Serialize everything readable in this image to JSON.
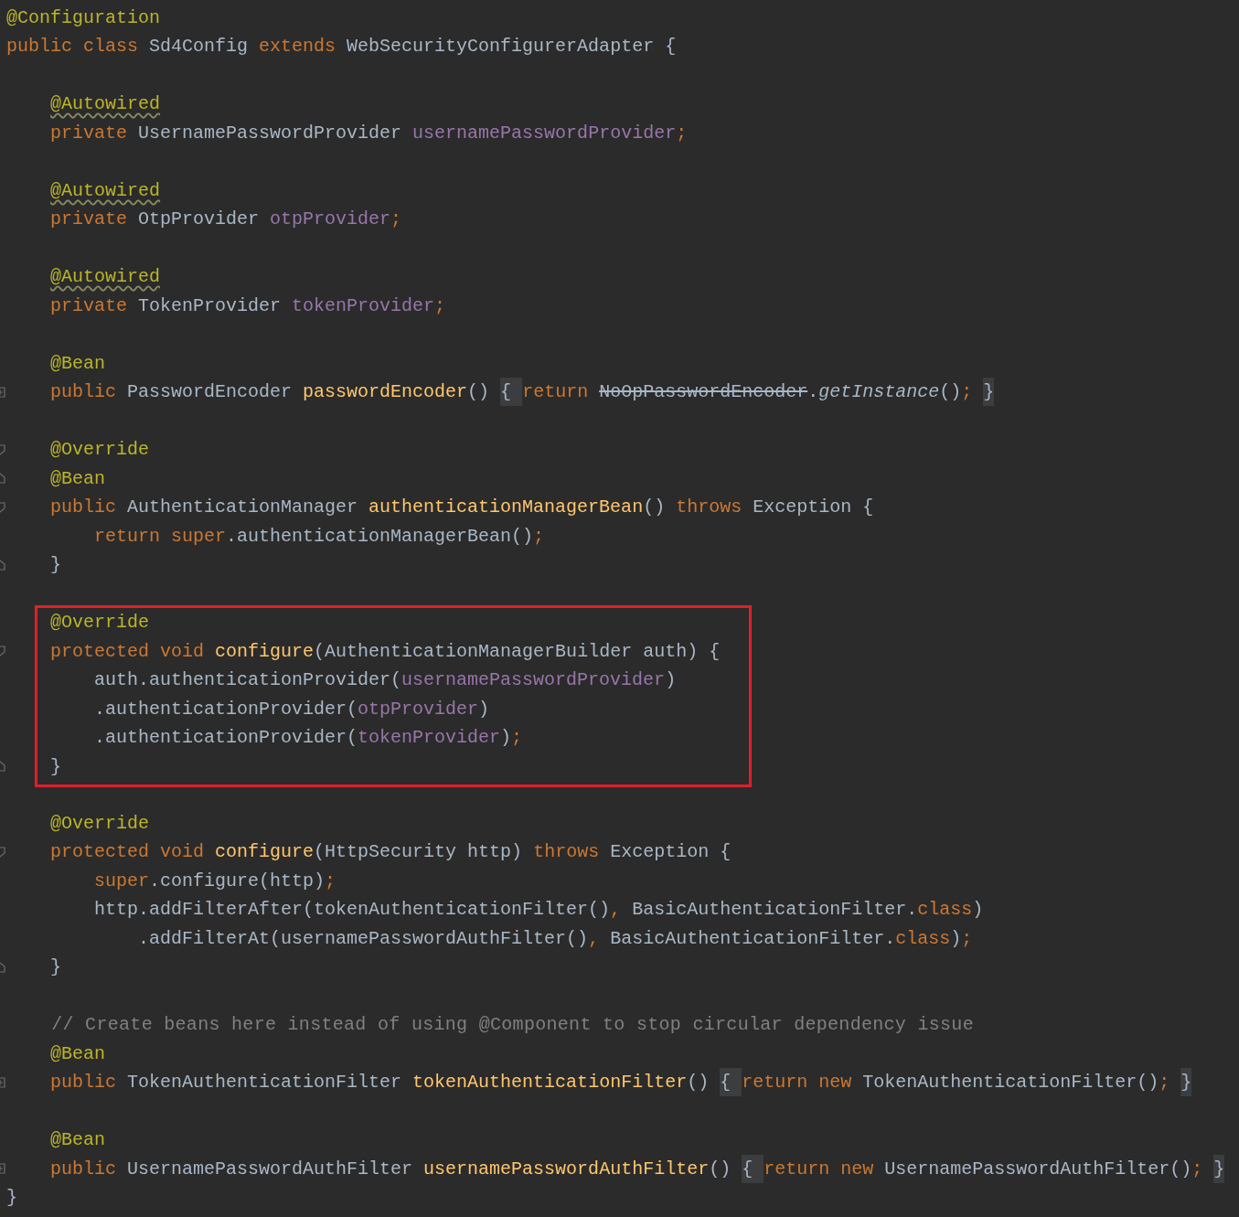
{
  "sections": [
    {
      "boxed": false,
      "lines": [
        {
          "kind": "code",
          "tokens": [
            {
              "kind": "ann",
              "text": "@Configuration"
            }
          ]
        },
        {
          "kind": "code",
          "tokens": [
            {
              "kind": "kw",
              "text": "public class "
            },
            {
              "kind": "pl",
              "text": "Sd4Config "
            },
            {
              "kind": "kw",
              "text": "extends "
            },
            {
              "kind": "pl",
              "text": "WebSecurityConfigurerAdapter {"
            }
          ]
        },
        {
          "kind": "blank"
        },
        {
          "kind": "code",
          "tokens": [
            {
              "kind": "annw",
              "text": "    @Autowired"
            }
          ]
        },
        {
          "kind": "code",
          "tokens": [
            {
              "kind": "kw",
              "text": "    private "
            },
            {
              "kind": "pl",
              "text": "UsernamePasswordProvider "
            },
            {
              "kind": "fld",
              "text": "usernamePasswordProvider"
            },
            {
              "kind": "kw",
              "text": ";"
            }
          ]
        },
        {
          "kind": "blank"
        },
        {
          "kind": "code",
          "tokens": [
            {
              "kind": "annw",
              "text": "    @Autowired"
            }
          ]
        },
        {
          "kind": "code",
          "tokens": [
            {
              "kind": "kw",
              "text": "    private "
            },
            {
              "kind": "pl",
              "text": "OtpProvider "
            },
            {
              "kind": "fld",
              "text": "otpProvider"
            },
            {
              "kind": "kw",
              "text": ";"
            }
          ]
        },
        {
          "kind": "blank"
        },
        {
          "kind": "code",
          "tokens": [
            {
              "kind": "annw",
              "text": "    @Autowired"
            }
          ]
        },
        {
          "kind": "code",
          "tokens": [
            {
              "kind": "kw",
              "text": "    private "
            },
            {
              "kind": "pl",
              "text": "TokenProvider "
            },
            {
              "kind": "fld",
              "text": "tokenProvider"
            },
            {
              "kind": "kw",
              "text": ";"
            }
          ]
        },
        {
          "kind": "blank"
        },
        {
          "kind": "code",
          "tokens": [
            {
              "kind": "ann",
              "text": "    @Bean"
            }
          ]
        },
        {
          "kind": "code",
          "fold_marker": {
            "kind": "collapsed"
          },
          "tokens": [
            {
              "kind": "kw",
              "text": "    public "
            },
            {
              "kind": "pl",
              "text": "PasswordEncoder "
            },
            {
              "kind": "mth",
              "text": "passwordEncoder"
            },
            {
              "kind": "pl",
              "text": "() "
            },
            {
              "kind": "fb",
              "text": "{ "
            },
            {
              "kind": "kw",
              "text": "return "
            },
            {
              "kind": "strike",
              "text": "NoOpPasswordEncoder"
            },
            {
              "kind": "pl",
              "text": "."
            },
            {
              "kind": "ital",
              "text": "getInstance"
            },
            {
              "kind": "pl",
              "text": "()"
            },
            {
              "kind": "kw",
              "text": "; "
            },
            {
              "kind": "fb",
              "text": "}"
            }
          ]
        },
        {
          "kind": "blank"
        },
        {
          "kind": "code",
          "fold_marker": {
            "kind": "open"
          },
          "tokens": [
            {
              "kind": "ann",
              "text": "    @Override"
            }
          ]
        },
        {
          "kind": "code",
          "fold_marker": {
            "kind": "close"
          },
          "tokens": [
            {
              "kind": "ann",
              "text": "    @Bean"
            }
          ]
        },
        {
          "kind": "code",
          "fold_marker": {
            "kind": "open"
          },
          "tokens": [
            {
              "kind": "kw",
              "text": "    public "
            },
            {
              "kind": "pl",
              "text": "AuthenticationManager "
            },
            {
              "kind": "mth",
              "text": "authenticationManagerBean"
            },
            {
              "kind": "pl",
              "text": "() "
            },
            {
              "kind": "kw",
              "text": "throws "
            },
            {
              "kind": "pl",
              "text": "Exception {"
            }
          ]
        },
        {
          "kind": "code",
          "tokens": [
            {
              "kind": "kw",
              "text": "        return super"
            },
            {
              "kind": "pl",
              "text": ".authenticationManagerBean()"
            },
            {
              "kind": "kw",
              "text": ";"
            }
          ]
        },
        {
          "kind": "code",
          "fold_marker": {
            "kind": "close"
          },
          "tokens": [
            {
              "kind": "pl",
              "text": "    }"
            }
          ]
        },
        {
          "kind": "blank"
        }
      ]
    },
    {
      "boxed": true,
      "lines": [
        {
          "kind": "code",
          "tokens": [
            {
              "kind": "ann",
              "text": "    @Override"
            }
          ]
        },
        {
          "kind": "code",
          "fold_marker": {
            "kind": "open"
          },
          "tokens": [
            {
              "kind": "kw",
              "text": "    protected void "
            },
            {
              "kind": "mth",
              "text": "configure"
            },
            {
              "kind": "pl",
              "text": "(AuthenticationManagerBuilder auth) {"
            }
          ]
        },
        {
          "kind": "code",
          "tokens": [
            {
              "kind": "pl",
              "text": "        auth.authenticationProvider("
            },
            {
              "kind": "fld",
              "text": "usernamePasswordProvider"
            },
            {
              "kind": "pl",
              "text": ")"
            }
          ]
        },
        {
          "kind": "code",
          "tokens": [
            {
              "kind": "pl",
              "text": "        .authenticationProvider("
            },
            {
              "kind": "fld",
              "text": "otpProvider"
            },
            {
              "kind": "pl",
              "text": ")"
            }
          ]
        },
        {
          "kind": "code",
          "tokens": [
            {
              "kind": "pl",
              "text": "        .authenticationProvider("
            },
            {
              "kind": "fld",
              "text": "tokenProvider"
            },
            {
              "kind": "pl",
              "text": ")"
            },
            {
              "kind": "kw",
              "text": ";"
            }
          ]
        },
        {
          "kind": "code",
          "fold_marker": {
            "kind": "close"
          },
          "tokens": [
            {
              "kind": "pl",
              "text": "    }"
            }
          ]
        }
      ]
    },
    {
      "boxed": false,
      "lines": [
        {
          "kind": "blank"
        },
        {
          "kind": "code",
          "tokens": [
            {
              "kind": "ann",
              "text": "    @Override"
            }
          ]
        },
        {
          "kind": "code",
          "fold_marker": {
            "kind": "open"
          },
          "tokens": [
            {
              "kind": "kw",
              "text": "    protected void "
            },
            {
              "kind": "mth",
              "text": "configure"
            },
            {
              "kind": "pl",
              "text": "(HttpSecurity http) "
            },
            {
              "kind": "kw",
              "text": "throws "
            },
            {
              "kind": "pl",
              "text": "Exception {"
            }
          ]
        },
        {
          "kind": "code",
          "tokens": [
            {
              "kind": "kw",
              "text": "        super"
            },
            {
              "kind": "pl",
              "text": ".configure(http)"
            },
            {
              "kind": "kw",
              "text": ";"
            }
          ]
        },
        {
          "kind": "code",
          "tokens": [
            {
              "kind": "pl",
              "text": "        http.addFilterAfter(tokenAuthenticationFilter()"
            },
            {
              "kind": "kw",
              "text": ", "
            },
            {
              "kind": "pl",
              "text": "BasicAuthenticationFilter."
            },
            {
              "kind": "kw",
              "text": "class"
            },
            {
              "kind": "pl",
              "text": ")"
            }
          ]
        },
        {
          "kind": "code",
          "tokens": [
            {
              "kind": "pl",
              "text": "            .addFilterAt(usernamePasswordAuthFilter()"
            },
            {
              "kind": "kw",
              "text": ", "
            },
            {
              "kind": "pl",
              "text": "BasicAuthenticationFilter."
            },
            {
              "kind": "kw",
              "text": "class"
            },
            {
              "kind": "pl",
              "text": ")"
            },
            {
              "kind": "kw",
              "text": ";"
            }
          ]
        },
        {
          "kind": "code",
          "fold_marker": {
            "kind": "close"
          },
          "tokens": [
            {
              "kind": "pl",
              "text": "    }"
            }
          ]
        },
        {
          "kind": "blank"
        },
        {
          "kind": "code",
          "tokens": [
            {
              "kind": "cm",
              "text": "    // Create beans here instead of using @Component to stop circular dependency issue"
            }
          ]
        },
        {
          "kind": "code",
          "tokens": [
            {
              "kind": "ann",
              "text": "    @Bean"
            }
          ]
        },
        {
          "kind": "code",
          "fold_marker": {
            "kind": "collapsed"
          },
          "tokens": [
            {
              "kind": "kw",
              "text": "    public "
            },
            {
              "kind": "pl",
              "text": "TokenAuthenticationFilter "
            },
            {
              "kind": "mth",
              "text": "tokenAuthenticationFilter"
            },
            {
              "kind": "pl",
              "text": "() "
            },
            {
              "kind": "fb",
              "text": "{ "
            },
            {
              "kind": "kw",
              "text": "return new "
            },
            {
              "kind": "pl",
              "text": "TokenAuthenticationFilter()"
            },
            {
              "kind": "kw",
              "text": "; "
            },
            {
              "kind": "fb",
              "text": "}"
            }
          ]
        },
        {
          "kind": "blank"
        },
        {
          "kind": "code",
          "tokens": [
            {
              "kind": "ann",
              "text": "    @Bean"
            }
          ]
        },
        {
          "kind": "code",
          "fold_marker": {
            "kind": "collapsed"
          },
          "tokens": [
            {
              "kind": "kw",
              "text": "    public "
            },
            {
              "kind": "pl",
              "text": "UsernamePasswordAuthFilter "
            },
            {
              "kind": "mth",
              "text": "usernamePasswordAuthFilter"
            },
            {
              "kind": "pl",
              "text": "() "
            },
            {
              "kind": "fb",
              "text": "{ "
            },
            {
              "kind": "kw",
              "text": "return new "
            },
            {
              "kind": "pl",
              "text": "UsernamePasswordAuthFilter()"
            },
            {
              "kind": "kw",
              "text": "; "
            },
            {
              "kind": "fb",
              "text": "}"
            }
          ]
        },
        {
          "kind": "code",
          "tokens": [
            {
              "kind": "pl",
              "text": "}"
            }
          ]
        }
      ]
    }
  ]
}
